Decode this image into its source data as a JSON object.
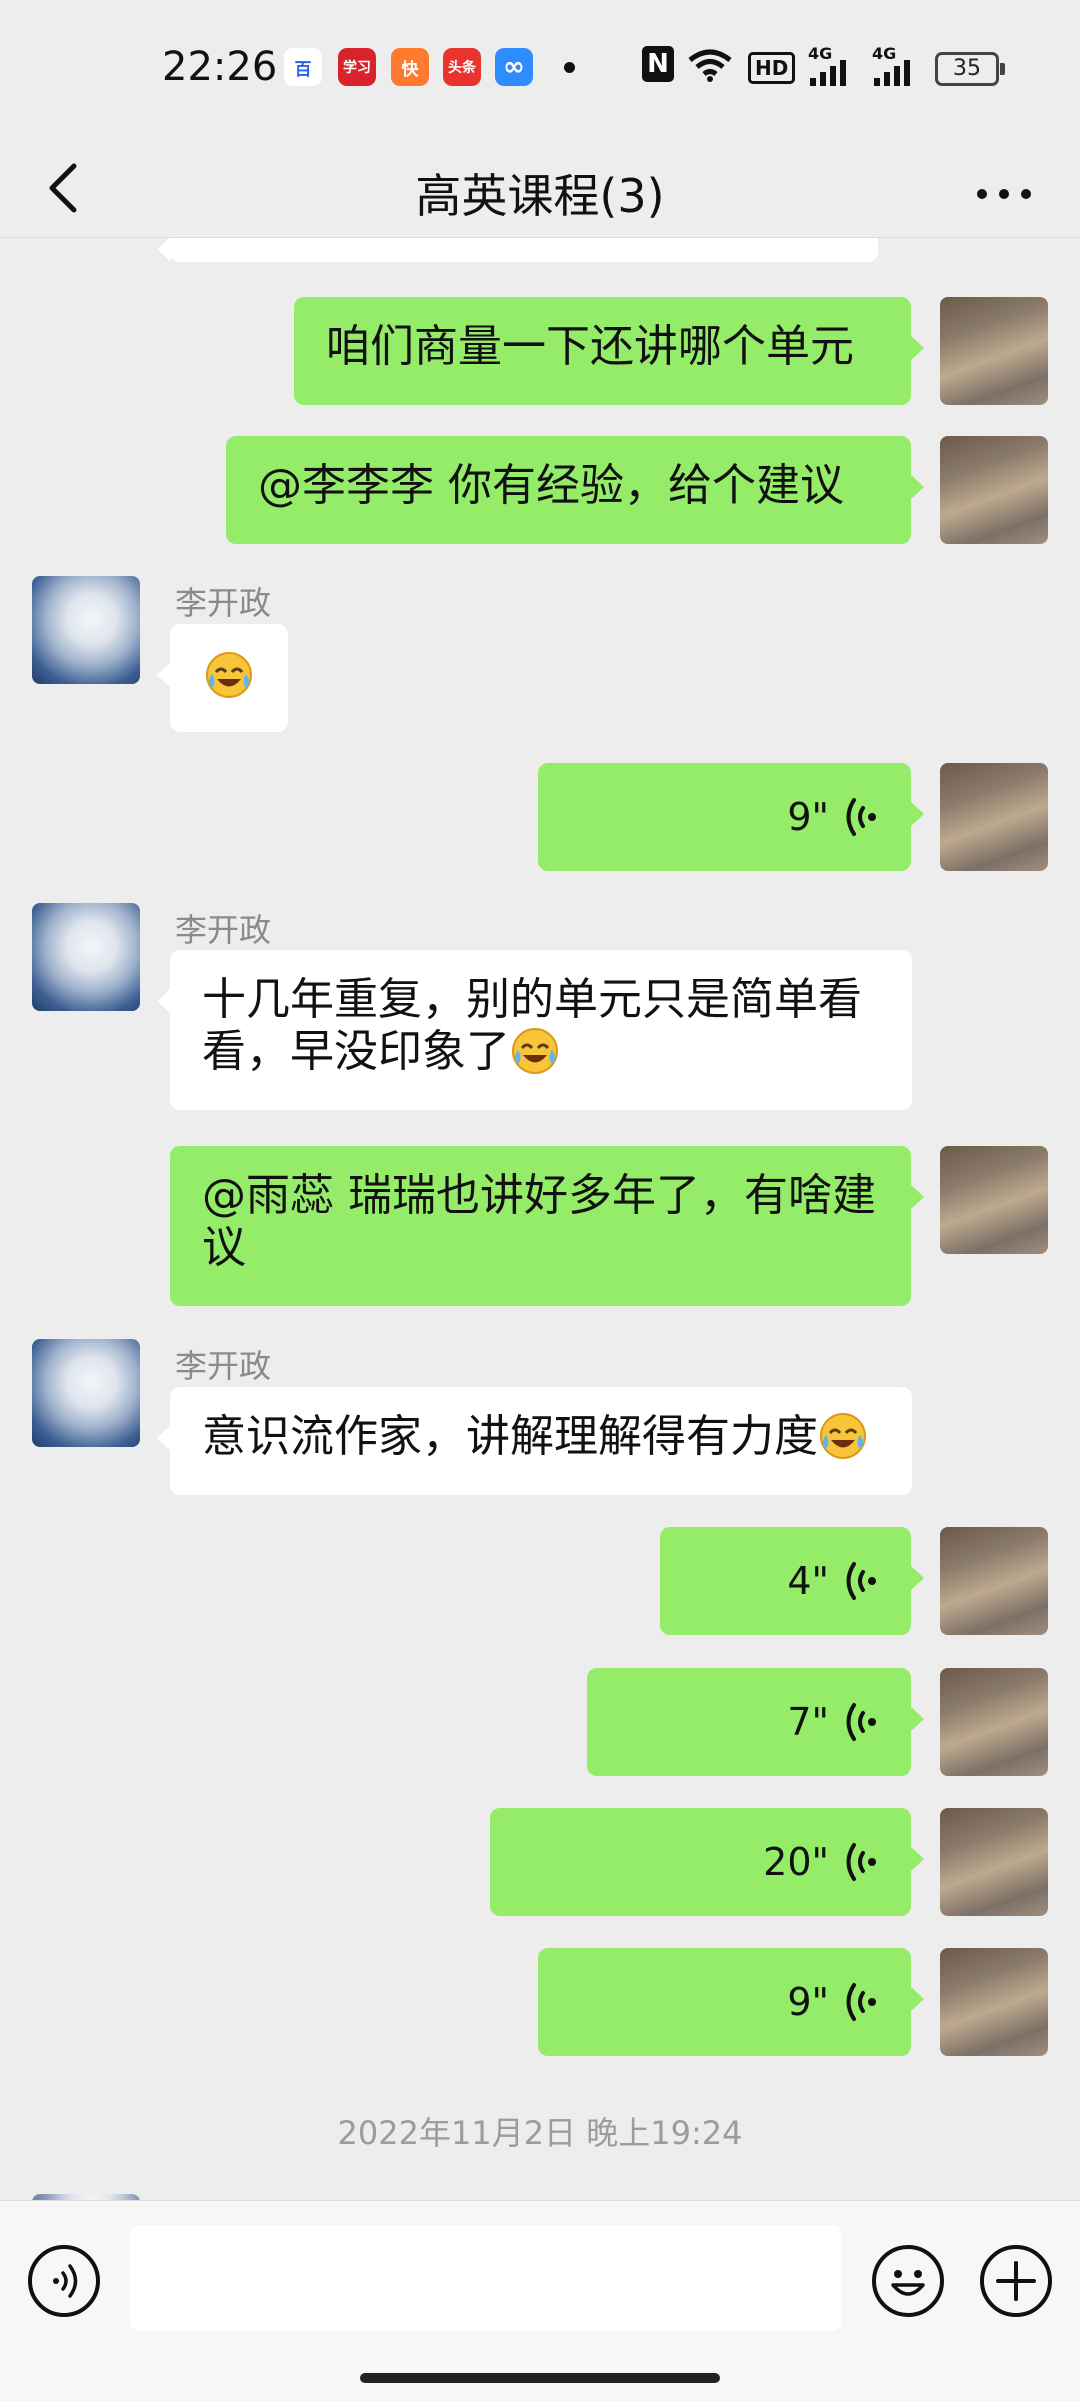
{
  "status_bar": {
    "time": "22:26",
    "apps": [
      {
        "icon": "baidu-app-icon",
        "label": "百",
        "color": "#ffffff",
        "text_color": "#2b61e6"
      },
      {
        "icon": "xuexi-app-icon",
        "label": "学习",
        "color": "#d8232a"
      },
      {
        "icon": "kuaishou-app-icon",
        "label": "快",
        "color": "#ff7a2e"
      },
      {
        "icon": "toutiao-app-icon",
        "label": "头条",
        "color": "#e8332e"
      },
      {
        "icon": "baidu-netdisk-app-icon",
        "label": "∞",
        "color": "#2f8cff"
      }
    ],
    "nfc": "N",
    "network_1": "4G",
    "network_2": "4G",
    "hd_label": "HD",
    "battery": "35"
  },
  "header": {
    "title": "高英课程(3)",
    "back_icon": "chevron-left-icon",
    "more_icon": "more-dots-icon"
  },
  "messages": [
    {
      "side": "me",
      "type": "text",
      "text": "咱们商量一下还讲哪个单元"
    },
    {
      "side": "me",
      "type": "text",
      "text": "@李李李  你有经验，给个建议"
    },
    {
      "side": "other",
      "sender": "李开政",
      "type": "emoji",
      "emoji": "face-with-tears-of-joy-icon"
    },
    {
      "side": "me",
      "type": "voice",
      "duration": "9\""
    },
    {
      "side": "other",
      "sender": "李开政",
      "type": "text",
      "text": "十几年重复，别的单元只是简单看看，早没印象了"
    },
    {
      "side": "me",
      "type": "text",
      "text": "@雨蕊  瑞瑞也讲好多年了，有啥建议"
    },
    {
      "side": "other",
      "sender": "李开政",
      "type": "text",
      "text": "意识流作家，讲解理解得有力度"
    },
    {
      "side": "me",
      "type": "voice",
      "duration": "4\""
    },
    {
      "side": "me",
      "type": "voice",
      "duration": "7\""
    },
    {
      "side": "me",
      "type": "voice",
      "duration": "20\""
    },
    {
      "side": "me",
      "type": "voice",
      "duration": "9\""
    }
  ],
  "timestamp": "2022年11月2日 晚上19:24",
  "input_bar": {
    "voice_icon": "voice-input-icon",
    "emoji_icon": "smiley-icon",
    "plus_icon": "plus-icon",
    "text_value": ""
  },
  "colors": {
    "my_bubble": "#95ec69",
    "other_bubble": "#ffffff",
    "background": "#ededed"
  }
}
